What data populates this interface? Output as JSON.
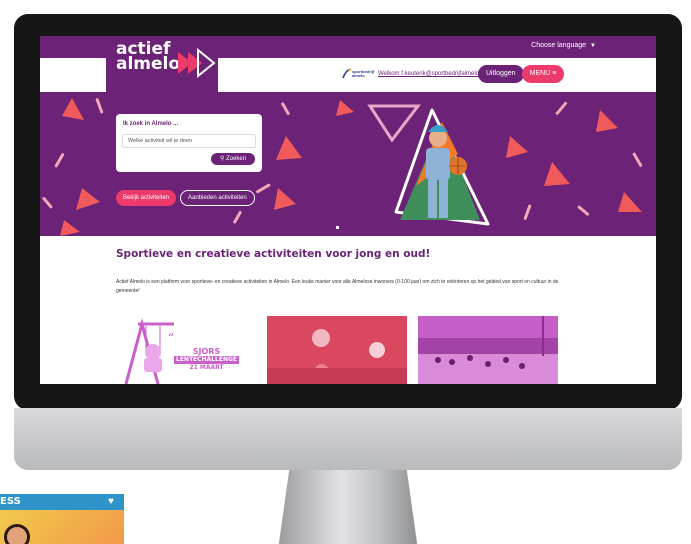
{
  "header": {
    "language_label": "Choose language",
    "logo_line1": "actief",
    "logo_line2": "almelo",
    "partner_logo_line1": "sportbedrijf",
    "partner_logo_line2": "almelo",
    "welcome_text": "Welkom f.keuterik@sportbedrijfalmelo.nl",
    "logout_label": "Uitloggen",
    "menu_label": "MENU ≡"
  },
  "hero": {
    "search_title": "Ik zoek in Almelo ...",
    "search_placeholder": "Welke activiteit wil je doen",
    "search_button": "⚲ Zoeken",
    "view_button": "Bekijk activiteiten",
    "offer_button": "Aanbieden activiteiten"
  },
  "content": {
    "headline": "Sportieve en creatieve activiteiten voor jong en oud!",
    "intro": "Actief Almelo is een platform voor sportieve- en creatieve activiteiten in Almelo. Een leuke manier voor alle Almelose inwoners (0-100 jaar) om zich te oriënteren op het gebied van sport en cultuur in de gemeente!",
    "cards": [
      {
        "title": "SJORS",
        "subtitle": "LENTECHALLENGE",
        "date": "21 MAART"
      },
      {
        "title": ""
      },
      {
        "title": ""
      }
    ]
  },
  "tablet": {
    "title": "ESS",
    "heart": "♥"
  },
  "colors": {
    "brand_purple": "#6b2277",
    "accent_pink": "#ec3a6b",
    "hero_triangle_red": "#f05a5a"
  }
}
